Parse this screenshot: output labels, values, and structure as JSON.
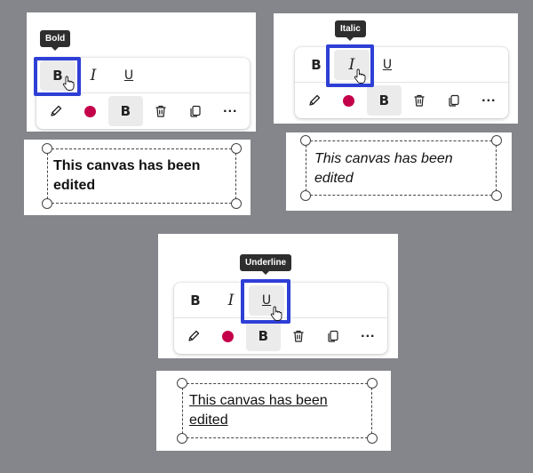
{
  "background_color": "#85868b",
  "highlight_color": "#2e3fd6",
  "accent_dot_color": "#c4004a",
  "panels": [
    {
      "tooltip": "Bold",
      "format_buttons": {
        "bold": "B",
        "italic": "I",
        "underline": "U"
      },
      "tool_bold": "B",
      "ellipsis": "...",
      "canvas_text_line1": "This canvas has been",
      "canvas_text_line2": "edited"
    },
    {
      "tooltip": "Italic",
      "format_buttons": {
        "bold": "B",
        "italic": "I",
        "underline": "U"
      },
      "tool_bold": "B",
      "ellipsis": "...",
      "canvas_text_line1": "This canvas has been",
      "canvas_text_line2": "edited"
    },
    {
      "tooltip": "Underline",
      "format_buttons": {
        "bold": "B",
        "italic": "I",
        "underline": "U"
      },
      "tool_bold": "B",
      "ellipsis": "...",
      "canvas_text_line1": "This canvas has been",
      "canvas_text_line2": "edited"
    }
  ]
}
